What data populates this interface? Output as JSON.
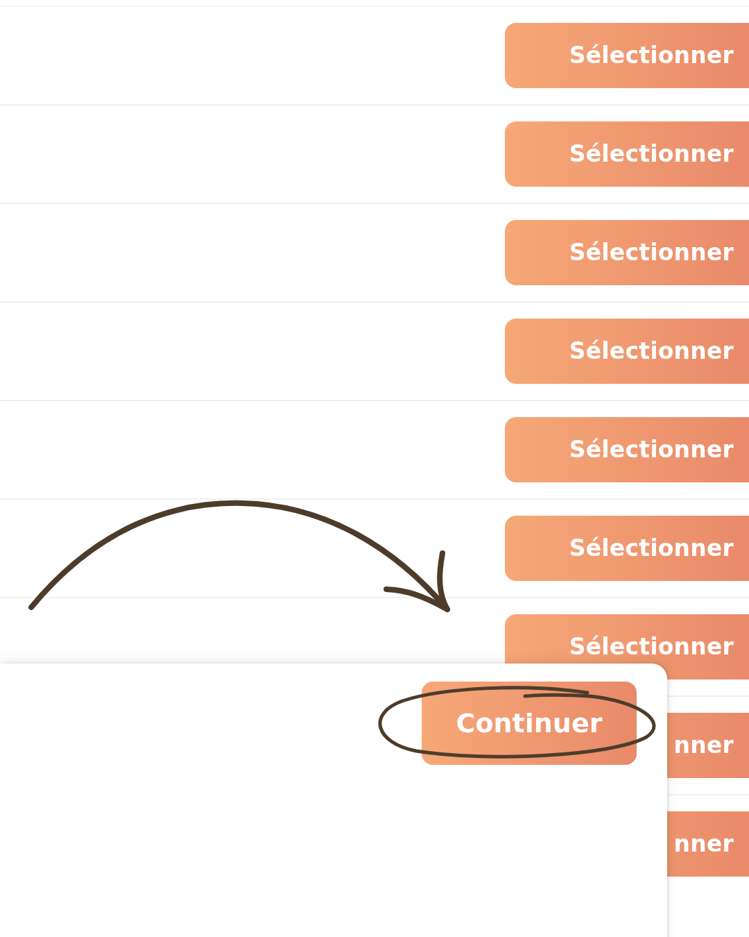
{
  "rows": [
    {
      "button": "Sélectionner"
    },
    {
      "button": "Sélectionner"
    },
    {
      "button": "Sélectionner"
    },
    {
      "button": "Sélectionner"
    },
    {
      "button": "Sélectionner"
    },
    {
      "button": "Sélectionner"
    },
    {
      "button": "Sélectionner"
    },
    {
      "button": "nner"
    },
    {
      "button": "nner"
    }
  ],
  "dialog": {
    "button": "Continuer"
  }
}
